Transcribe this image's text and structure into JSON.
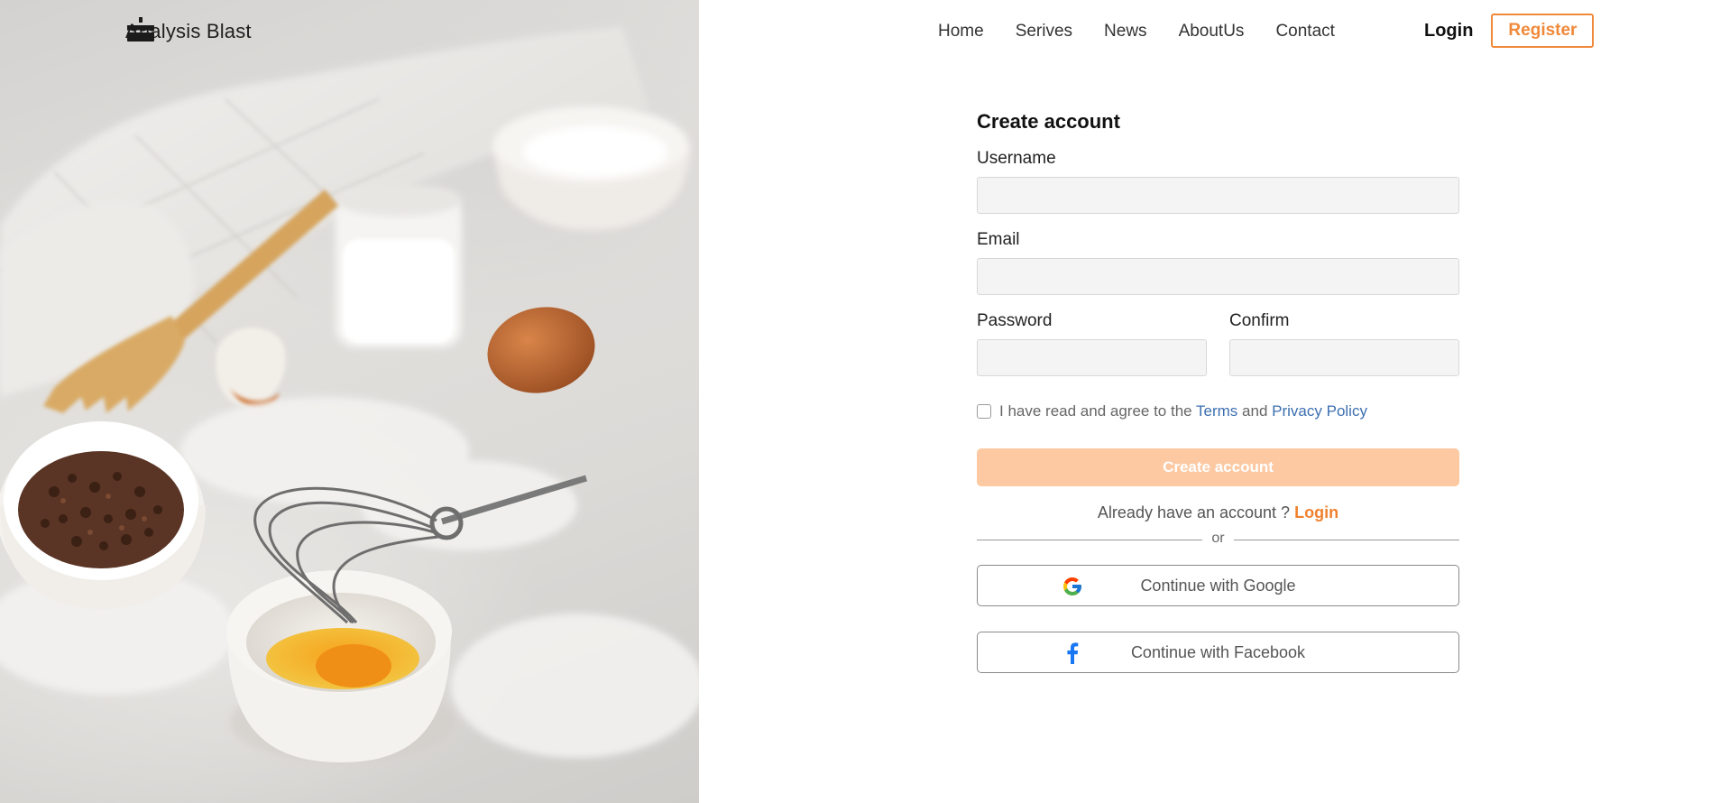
{
  "brand": {
    "name": "Analysis Blast",
    "icon": "cake-icon"
  },
  "nav": {
    "links": [
      "Home",
      "Serives",
      "News",
      "AboutUs",
      "Contact"
    ],
    "login": "Login",
    "register": "Register"
  },
  "form": {
    "title": "Create account",
    "username_label": "Username",
    "email_label": "Email",
    "password_label": "Password",
    "confirm_label": "Confirm",
    "username_value": "",
    "email_value": "",
    "password_value": "",
    "confirm_value": "",
    "agree_prefix": "I have read and agree to the",
    "terms": "Terms",
    "and": "and",
    "privacy": "Privacy Policy",
    "submit": "Create account",
    "already_text": "Already have an account ?",
    "already_login": "Login",
    "or": "or",
    "google": "Continue with Google",
    "facebook": "Continue with Facebook"
  },
  "colors": {
    "accent": "#f0893a",
    "submit_disabled": "#fcc9a2",
    "link_blue": "#3d6fb0",
    "field_bg": "#f4f4f4"
  }
}
